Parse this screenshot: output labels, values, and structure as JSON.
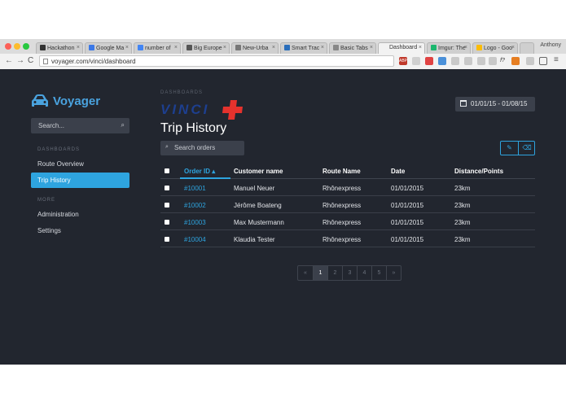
{
  "browser": {
    "user": "Anthony",
    "url": "voyager.com/vinci/dashboard",
    "tabs": [
      {
        "label": "Hackathon",
        "color": "#333333"
      },
      {
        "label": "Google Ma",
        "color": "#3b78e7"
      },
      {
        "label": "number of",
        "color": "#4285f4"
      },
      {
        "label": "Big Europe",
        "color": "#555555"
      },
      {
        "label": "New-Urba",
        "color": "#777777"
      },
      {
        "label": "Smart Trac",
        "color": "#2a6ebb"
      },
      {
        "label": "Basic Tabs",
        "color": "#888888"
      },
      {
        "label": "Dashboard",
        "color": "#ffffff"
      },
      {
        "label": "Imgur: The",
        "color": "#1bb76e"
      },
      {
        "label": "Logo - Goo",
        "color": "#fbbc05"
      }
    ],
    "extensions": [
      {
        "label": "ABP",
        "color": "#c0392b"
      },
      {
        "label": "",
        "color": "#d0d0d0"
      },
      {
        "label": "",
        "color": "#d0d0d0"
      },
      {
        "label": "",
        "color": "#e04343"
      },
      {
        "label": "",
        "color": "#4a90d9"
      },
      {
        "label": "",
        "color": "#d0d0d0"
      },
      {
        "label": "",
        "color": "#d0d0d0"
      },
      {
        "label": "",
        "color": "#d0d0d0"
      },
      {
        "label": "f?",
        "color": "#555555"
      },
      {
        "label": "",
        "color": "#e67e22"
      },
      {
        "label": "",
        "color": "#d0d0d0"
      },
      {
        "label": "",
        "color": "#d0d0d0"
      }
    ]
  },
  "sidebar": {
    "brand": "Voyager",
    "search_placeholder": "Search...",
    "sections": [
      {
        "label": "DASHBOARDS",
        "items": [
          "Route Overview",
          "Trip History"
        ]
      },
      {
        "label": "MORE",
        "items": [
          "Administration",
          "Settings"
        ]
      }
    ],
    "active_item": "Trip History"
  },
  "main": {
    "breadcrumb": "DASHBOARDS",
    "logo_text": "VINCI",
    "title": "Trip History",
    "date_range": "01/01/15 - 01/08/15",
    "search_placeholder": "Search orders",
    "table": {
      "columns": [
        "Order ID",
        "Customer name",
        "Route Name",
        "Date",
        "Distance/Points"
      ],
      "sort_column": "Order ID",
      "sort_direction": "asc",
      "rows": [
        [
          "#10001",
          "Manuel Neuer",
          "Rhônexpress",
          "01/01/2015",
          "23km"
        ],
        [
          "#10002",
          "Jérôme Boateng",
          "Rhônexpress",
          "01/01/2015",
          "23km"
        ],
        [
          "#10003",
          "Max Mustermann",
          "Rhônexpress",
          "01/01/2015",
          "23km"
        ],
        [
          "#10004",
          "Klaudia Tester",
          "Rhônexpress",
          "01/01/2015",
          "23km"
        ]
      ]
    },
    "pagination": [
      "«",
      "1",
      "2",
      "3",
      "4",
      "5",
      "»"
    ],
    "current_page": "1"
  },
  "colors": {
    "background": "#22262f",
    "panel": "#3b404b",
    "accent": "#2ea4df",
    "brand_blue": "#4aa3df",
    "logo_red": "#e5322d",
    "logo_navy": "#1d3f8f"
  }
}
